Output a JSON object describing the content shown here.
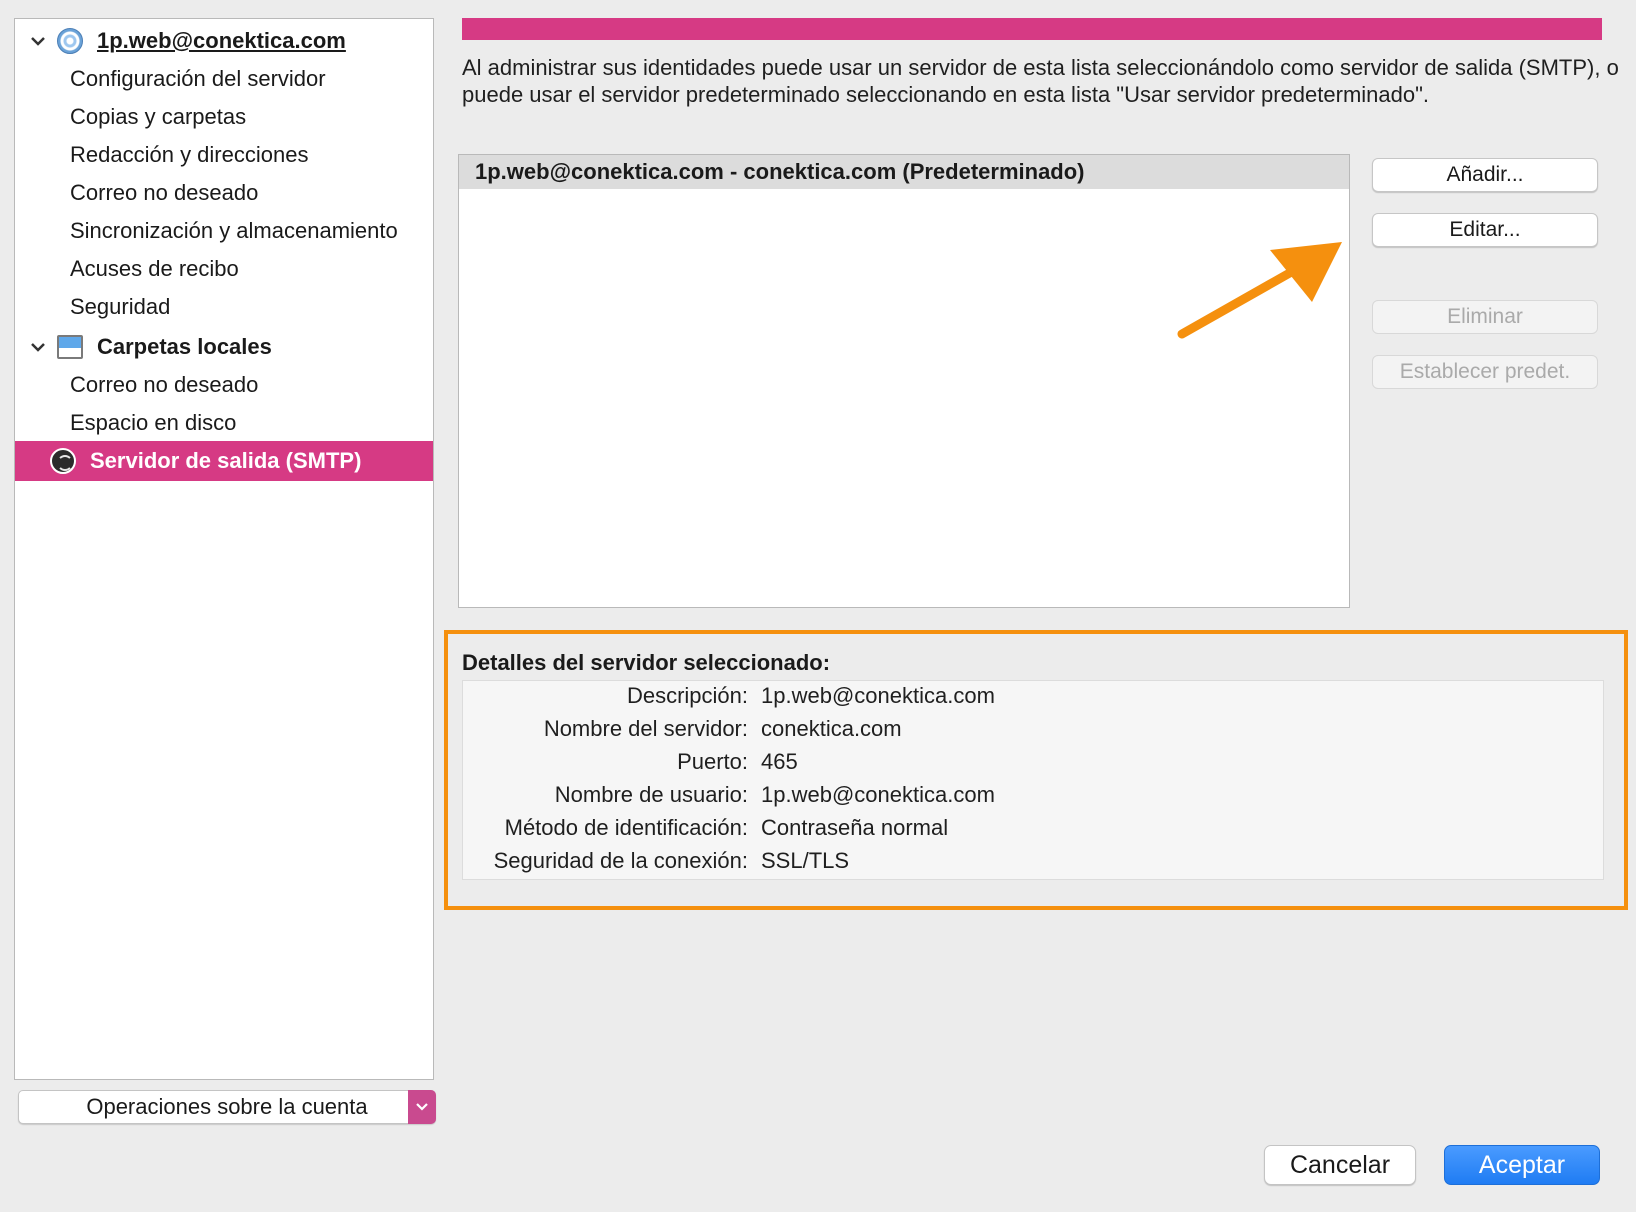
{
  "sidebar": {
    "account": {
      "name": "1p.web@conektica.com",
      "items": [
        "Configuración del servidor",
        "Copias y carpetas",
        "Redacción y direcciones",
        "Correo no deseado",
        "Sincronización y almacenamiento",
        "Acuses de recibo",
        "Seguridad"
      ]
    },
    "local": {
      "name": "Carpetas locales",
      "items": [
        "Correo no deseado",
        "Espacio en disco"
      ]
    },
    "smtp": {
      "label": "Servidor de salida (SMTP)",
      "selected": true
    },
    "account_ops_label": "Operaciones sobre la cuenta",
    "selection_color": "#d63a84"
  },
  "main": {
    "intro": "Al administrar sus identidades puede usar un servidor de esta lista seleccionándolo como servidor de salida (SMTP), o puede usar el servidor predeterminado seleccionando en esta lista \"Usar servidor predeterminado\".",
    "servers": [
      "1p.web@conektica.com - conektica.com (Predeterminado)"
    ],
    "buttons": {
      "add": "Añadir...",
      "edit": "Editar...",
      "delete": "Eliminar",
      "set_default": "Establecer predet."
    },
    "details": {
      "title": "Detalles del servidor seleccionado:",
      "rows": [
        {
          "label": "Descripción:",
          "value": "1p.web@conektica.com"
        },
        {
          "label": "Nombre del servidor:",
          "value": "conektica.com"
        },
        {
          "label": "Puerto:",
          "value": "465"
        },
        {
          "label": "Nombre de usuario:",
          "value": "1p.web@conektica.com"
        },
        {
          "label": "Método de identificación:",
          "value": "Contraseña normal"
        },
        {
          "label": "Seguridad de la conexión:",
          "value": "SSL/TLS"
        }
      ]
    },
    "highlight_color": "#f5900e"
  },
  "footer": {
    "cancel": "Cancelar",
    "accept": "Aceptar"
  }
}
